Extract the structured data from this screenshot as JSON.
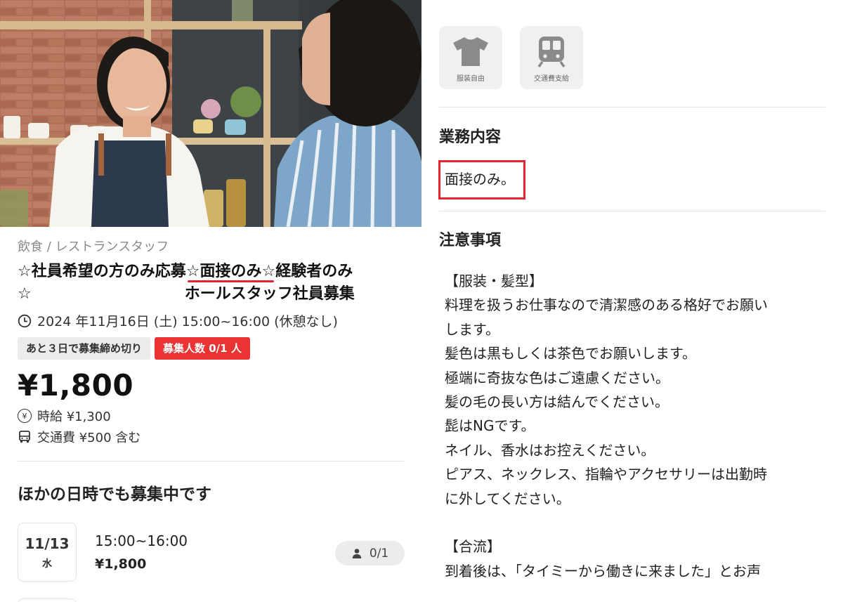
{
  "job": {
    "category": "飲食 / レストランスタッフ",
    "title_line1_a": "☆社員希望の方のみ応募",
    "title_line1_mark": "☆面接のみ☆",
    "title_line1_b": "経験者のみ",
    "title_line2_a": "☆",
    "title_line2_b": "ホールスタッフ社員募集",
    "datetime": "2024 年11月16日 (土) 15:00~16:00 (休憩なし)",
    "badge_deadline": "あと３日で募集締め切り",
    "badge_count": "募集人数 0/1 人",
    "price": "¥1,800",
    "hourly": "時給 ¥1,300",
    "transport": "交通費 ¥500 含む"
  },
  "other_dates": {
    "heading": "ほかの日時でも募集中です",
    "slots": [
      {
        "date": "11/13",
        "weekday": "水",
        "time": "15:00~16:00",
        "price": "¥1,800",
        "capacity": "0/1"
      }
    ]
  },
  "features": [
    {
      "icon": "tshirt-icon",
      "label": "服装自由"
    },
    {
      "icon": "train-icon",
      "label": "交通費支給"
    }
  ],
  "duties": {
    "heading": "業務内容",
    "text": "面接のみ。"
  },
  "notes": {
    "heading": "注意事項",
    "lines": [
      "【服装・髪型】",
      "料理を扱うお仕事なので清潔感のある格好でお願い",
      "します。",
      "髪色は黒もしくは茶色でお願いします。",
      "極端に奇抜な色はご遠慮ください。",
      "髪の毛の長い方は結んでください。",
      "髭はNGです。",
      "ネイル、香水はお控えください。",
      "ピアス、ネックレス、指輪やアクセサリーは出勤時",
      "に外してください。",
      "",
      "【合流】",
      "到着後は、「タイミーから働きに来ました」とお声"
    ]
  },
  "colors": {
    "accent_red": "#e5252d",
    "badge_red": "#ea3434",
    "badge_gray": "#ececec"
  }
}
